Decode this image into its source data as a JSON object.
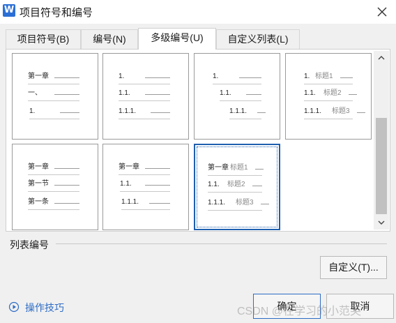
{
  "window": {
    "title": "项目符号和编号",
    "app_icon_letter": "W"
  },
  "tabs": [
    {
      "label": "项目符号(B)",
      "active": false
    },
    {
      "label": "编号(N)",
      "active": false
    },
    {
      "label": "多级编号(U)",
      "active": true
    },
    {
      "label": "自定义列表(L)",
      "active": false
    }
  ],
  "gallery": [
    {
      "rows": [
        {
          "label": "第一章",
          "title": ""
        },
        {
          "label": "一、",
          "title": ""
        },
        {
          "label": "1.",
          "title": ""
        }
      ]
    },
    {
      "rows": [
        {
          "label": "1.",
          "title": ""
        },
        {
          "label": "1.1.",
          "title": ""
        },
        {
          "label": "1.1.1.",
          "title": ""
        }
      ]
    },
    {
      "rows": [
        {
          "label": "1.",
          "title": ""
        },
        {
          "label": "1.1.",
          "title": ""
        },
        {
          "label": "1.1.1.",
          "title": ""
        }
      ]
    },
    {
      "rows": [
        {
          "label": "1.",
          "title": "标题1"
        },
        {
          "label": "1.1.",
          "title": "标题2"
        },
        {
          "label": "1.1.1.",
          "title": "标题3"
        }
      ]
    },
    {
      "rows": [
        {
          "label": "第一章",
          "title": ""
        },
        {
          "label": "第一节",
          "title": ""
        },
        {
          "label": "第一条",
          "title": ""
        }
      ]
    },
    {
      "rows": [
        {
          "label": "第一章",
          "title": ""
        },
        {
          "label": "1.1.",
          "title": ""
        },
        {
          "label": "1.1.1.",
          "title": ""
        }
      ]
    },
    {
      "rows": [
        {
          "label": "第一章",
          "title": "标题1"
        },
        {
          "label": "1.1.",
          "title": "标题2"
        },
        {
          "label": "1.1.1.",
          "title": "标题3"
        }
      ],
      "selected": true
    }
  ],
  "section": {
    "label": "列表编号"
  },
  "buttons": {
    "custom": "自定义(T)...",
    "ok": "确定",
    "cancel": "取消"
  },
  "tips": {
    "label": "操作技巧",
    "icon": "play-circle-icon"
  },
  "watermark": "CSDN @在学习的小范芙",
  "colors": {
    "accent": "#2d6cc5",
    "selected_border": "#1e5fae",
    "app_icon": "#2b6fd6"
  }
}
